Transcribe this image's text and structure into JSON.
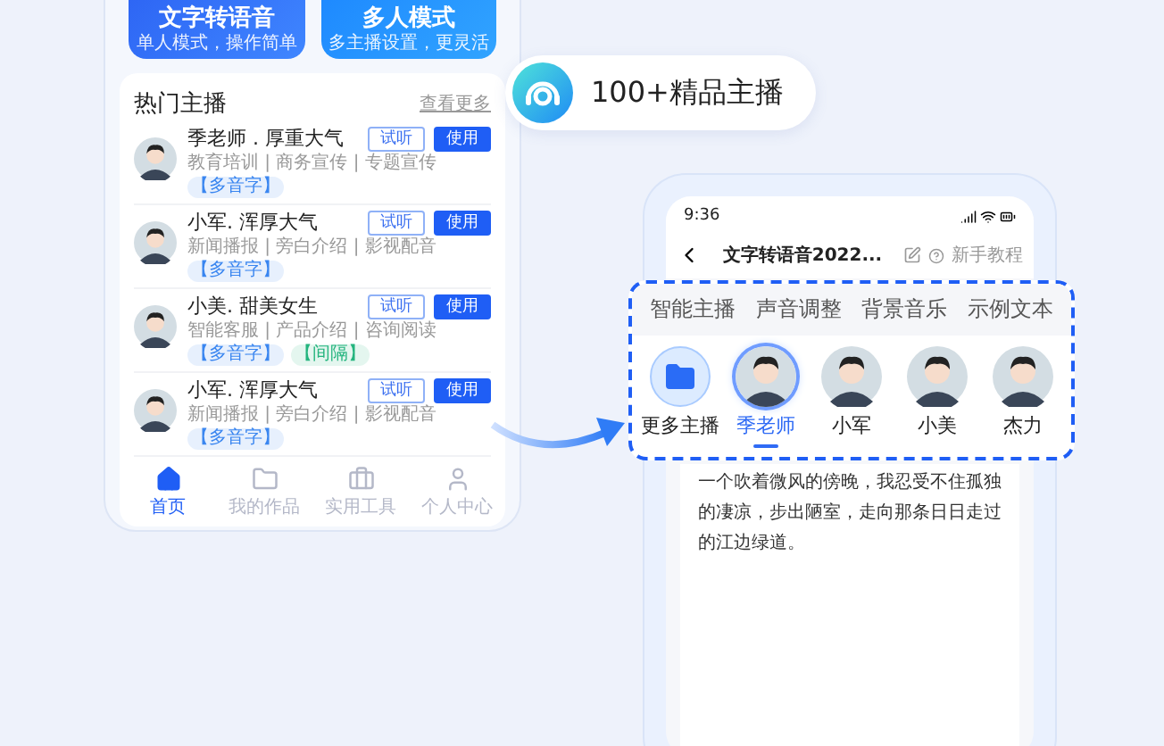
{
  "left_phone": {
    "mode_cards": [
      {
        "title": "文字转语音",
        "subtitle": "单人模式，操作简单"
      },
      {
        "title": "多人模式",
        "subtitle": "多主播设置，更灵活"
      }
    ],
    "section_title": "热门主播",
    "more_link": "查看更多",
    "anchors": [
      {
        "name": "季老师 . 厚重大气",
        "tags": "教育培训 | 商务宣传 | 专题宣传",
        "badges": [
          {
            "label": "【多音字】",
            "color": "#3a86f0"
          }
        ],
        "listen": "试听",
        "use": "使用"
      },
      {
        "name": "小军. 浑厚大气",
        "tags": "新闻播报 | 旁白介绍 | 影视配音",
        "badges": [
          {
            "label": "【多音字】",
            "color": "#3a86f0"
          }
        ],
        "listen": "试听",
        "use": "使用"
      },
      {
        "name": "小美. 甜美女生",
        "tags": "智能客服 | 产品介绍 | 咨询阅读",
        "badges": [
          {
            "label": "【多音字】",
            "color": "#3a86f0"
          },
          {
            "label": "【间隔】",
            "color": "#24b47e"
          }
        ],
        "listen": "试听",
        "use": "使用"
      },
      {
        "name": "小军. 浑厚大气",
        "tags": "新闻播报 | 旁白介绍 | 影视配音",
        "badges": [
          {
            "label": "【多音字】",
            "color": "#3a86f0"
          }
        ],
        "listen": "试听",
        "use": "使用"
      }
    ],
    "nav": [
      {
        "label": "首页",
        "kind": "home",
        "selected": true
      },
      {
        "label": "我的作品",
        "kind": "folder",
        "selected": false
      },
      {
        "label": "实用工具",
        "kind": "tools",
        "selected": false
      },
      {
        "label": "个人中心",
        "kind": "profile",
        "selected": false
      }
    ]
  },
  "badge": {
    "label": "100+精品主播"
  },
  "right_phone": {
    "time": "9:36",
    "title": "文字转语音2022...",
    "help": "新手教程",
    "panel_tabs": [
      {
        "label": "智能主播",
        "selected": false
      },
      {
        "label": "声音调整",
        "selected": false
      },
      {
        "label": "背景音乐",
        "selected": false
      },
      {
        "label": "示例文本",
        "selected": false
      }
    ],
    "voices": [
      {
        "name": "更多主播",
        "kind": "more",
        "selected": false
      },
      {
        "name": "季老师",
        "kind": "avatar",
        "selected": true
      },
      {
        "name": "小军",
        "kind": "avatar",
        "selected": false
      },
      {
        "name": "小美",
        "kind": "avatar",
        "selected": false
      },
      {
        "name": "杰力",
        "kind": "avatar",
        "selected": false
      }
    ],
    "text": "一个吹着微风的傍晚，我忍受不住孤独的凄凉，步出陋室，走向那条日日走过的江边绿道。"
  }
}
